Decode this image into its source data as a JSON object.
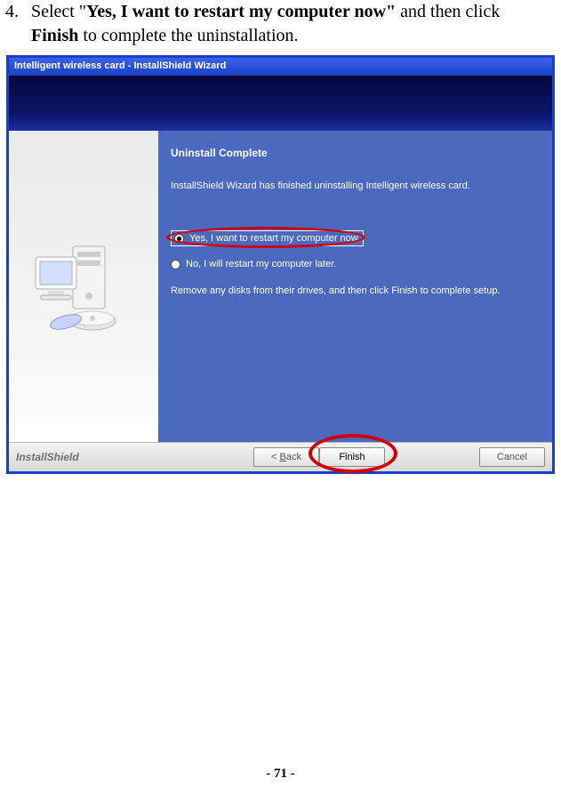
{
  "instruction": {
    "number": "4.",
    "prefix": "Select \"",
    "bold1": "Yes, I want to restart my computer now\"",
    "mid": " and then click ",
    "bold2": "Finish",
    "suffix": " to complete the uninstallation."
  },
  "wizard": {
    "title": "Intelligent wireless card - InstallShield Wizard",
    "heading": "Uninstall Complete",
    "desc": "InstallShield Wizard has finished uninstalling Intelligent wireless card.",
    "radio_yes": "Yes, I want to restart my computer now.",
    "radio_no": "No, I will restart my computer later.",
    "note": "Remove any disks from their drives, and then click Finish to complete setup.",
    "brand": "InstallShield",
    "back_prefix": "< ",
    "back_letter": "B",
    "back_rest": "ack",
    "finish": "Finish",
    "cancel": "Cancel"
  },
  "page_number": "- 71 -"
}
